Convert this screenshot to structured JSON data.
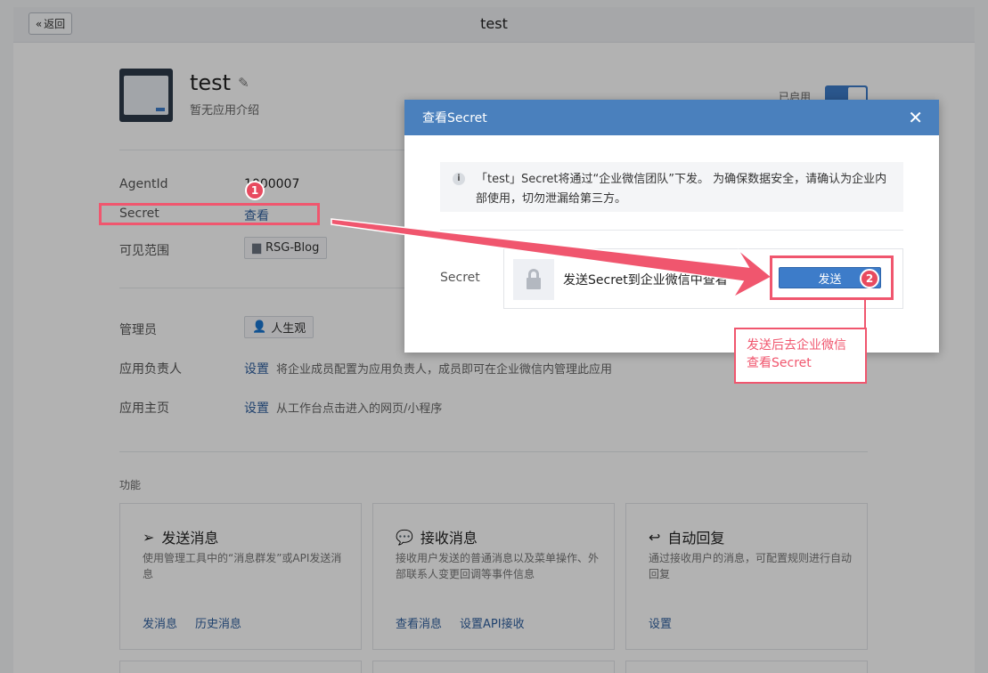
{
  "header": {
    "back_label": "返回",
    "title": "test"
  },
  "app": {
    "name": "test",
    "description": "暂无应用介绍",
    "status_label": "已启用"
  },
  "info_rows": {
    "agentid_label": "AgentId",
    "agentid_value": "1000007",
    "secret_label": "Secret",
    "secret_link": "查看",
    "visible_label": "可见范围",
    "visible_tag": "RSG-Blog"
  },
  "admin_rows": {
    "admin_label": "管理员",
    "admin_tag": "人生观",
    "owner_label": "应用负责人",
    "owner_link": "设置",
    "owner_desc": "将企业成员配置为应用负责人，成员即可在企业微信内管理此应用",
    "home_label": "应用主页",
    "home_link": "设置",
    "home_desc": "从工作台点击进入的网页/小程序"
  },
  "features": {
    "section_label": "功能",
    "cards": [
      {
        "title": "发送消息",
        "desc": "使用管理工具中的“消息群发”或API发送消息",
        "link1": "发消息",
        "link2": "历史消息"
      },
      {
        "title": "接收消息",
        "desc": "接收用户发送的普通消息以及菜单操作、外部联系人变更回调等事件信息",
        "link1": "查看消息",
        "link2": "设置API接收"
      },
      {
        "title": "自动回复",
        "desc": "通过接收用户的消息，可配置规则进行自动回复",
        "link1": "设置"
      }
    ]
  },
  "modal": {
    "title": "查看Secret",
    "notice": "「test」Secret将通过“企业微信团队”下发。 为确保数据安全，请确认为企业内部使用，切勿泄漏给第三方。",
    "secret_label": "Secret",
    "secret_text": "发送Secret到企业微信中查看",
    "send_label": "发送"
  },
  "annotations": {
    "badge1": "1",
    "badge2": "2",
    "callout": "发送后去企业微信查看Secret"
  },
  "colors": {
    "accent": "#3d7cc9",
    "header": "#4a80bd",
    "annotation": "#f0566e"
  }
}
